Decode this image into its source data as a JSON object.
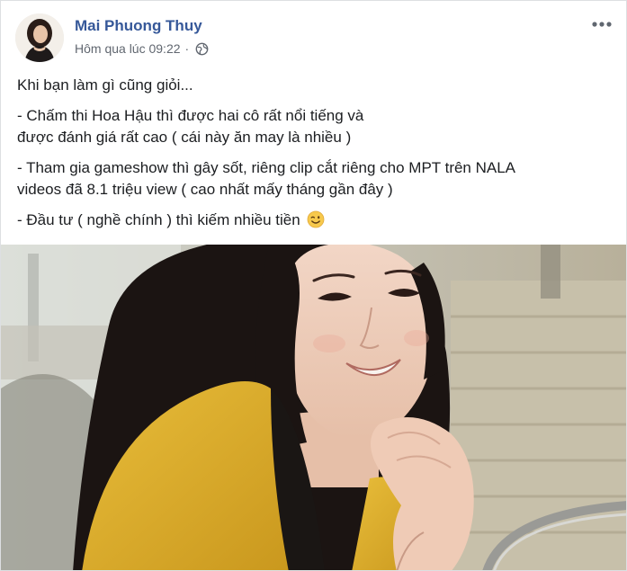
{
  "post": {
    "author": "Mai Phuong Thuy",
    "timestamp": "Hôm qua lúc 09:22",
    "separator": "·",
    "privacy_icon": "globe-icon",
    "more_icon": "ellipsis-icon",
    "paragraphs": [
      {
        "lines": [
          "Khi bạn làm gì cũng giỏi..."
        ]
      },
      {
        "lines": [
          "- Chấm thi Hoa Hậu thì được hai cô rất nổi tiếng và",
          "được đánh giá rất cao ( cái này ăn may là nhiều )"
        ]
      },
      {
        "lines": [
          "- Tham gia gameshow thì gây sốt, riêng clip cắt riêng cho MPT trên NALA",
          "videos đã 8.1 triệu view ( cao nhất mấy tháng gần đây )"
        ]
      },
      {
        "lines": [
          "- Đầu tư ( nghề chính ) thì kiếm nhiều tiền"
        ],
        "emoji": "winking-face-icon"
      }
    ],
    "photo": {
      "jacket_color": "#e0b22e",
      "background_color": "#bcb7a8",
      "hair_color": "#1b1412"
    }
  }
}
